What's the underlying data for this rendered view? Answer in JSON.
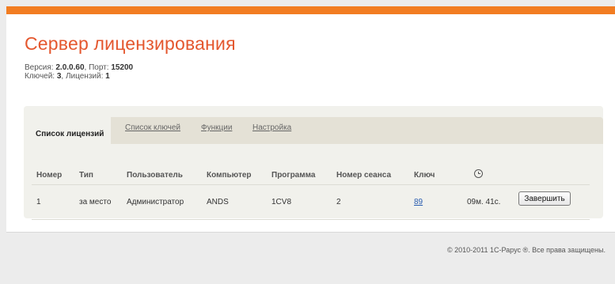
{
  "header": {
    "title": "Сервер лицензирования",
    "version_label": "Версия:",
    "version": "2.0.0.60",
    "port_label": "Порт:",
    "port": "15200",
    "keys_label": "Ключей:",
    "keys": "3",
    "licenses_label": "Лицензий:",
    "licenses": "1"
  },
  "tabs": [
    {
      "label": "Список лицензий",
      "active": true
    },
    {
      "label": "Список ключей",
      "active": false
    },
    {
      "label": "Функции",
      "active": false
    },
    {
      "label": "Настройка",
      "active": false
    }
  ],
  "table": {
    "columns": [
      "Номер",
      "Тип",
      "Пользователь",
      "Компьютер",
      "Программа",
      "Номер сеанса",
      "Ключ",
      "clock-icon"
    ],
    "rows": [
      {
        "number": "1",
        "type": "за место",
        "user": "Администратор",
        "computer": "ANDS",
        "program": "1CV8",
        "session": "2",
        "key": "89",
        "duration": "09м. 41с.",
        "action": "Завершить"
      }
    ]
  },
  "footer": {
    "copyright": "© 2010-2011 1С-Рарус ®. Все права защищены."
  },
  "colors": {
    "accent": "#f27d22",
    "title": "#e4572e",
    "link": "#2a5db0"
  }
}
